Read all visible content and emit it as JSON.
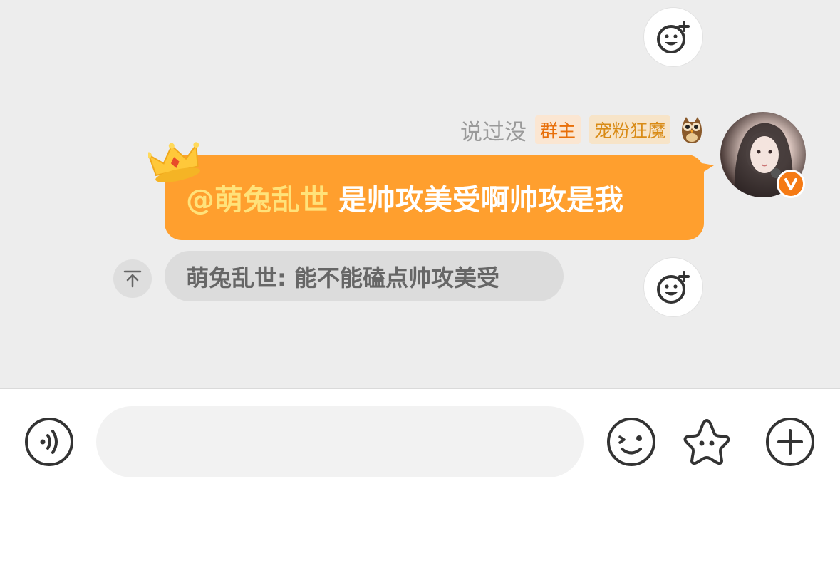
{
  "message": {
    "sender_name": "说过没",
    "badges": [
      "群主",
      "宠粉狂魔"
    ],
    "mention": "@萌兔乱世",
    "text": "是帅攻美受啊帅攻是我"
  },
  "quote": {
    "text": "萌兔乱世: 能不能磕点帅攻美受"
  },
  "input": {
    "placeholder": ""
  },
  "colors": {
    "accent": "#ff9f2e",
    "mention": "#ffe27a",
    "badge_text": "#e86f0a",
    "verified": "#f57a14"
  },
  "icons": [
    "emoji-react-icon",
    "owl-icon",
    "crown-icon",
    "verified-v-icon",
    "quote-up-icon",
    "voice-icon",
    "emoji-icon",
    "sticker-star-icon",
    "plus-icon"
  ]
}
